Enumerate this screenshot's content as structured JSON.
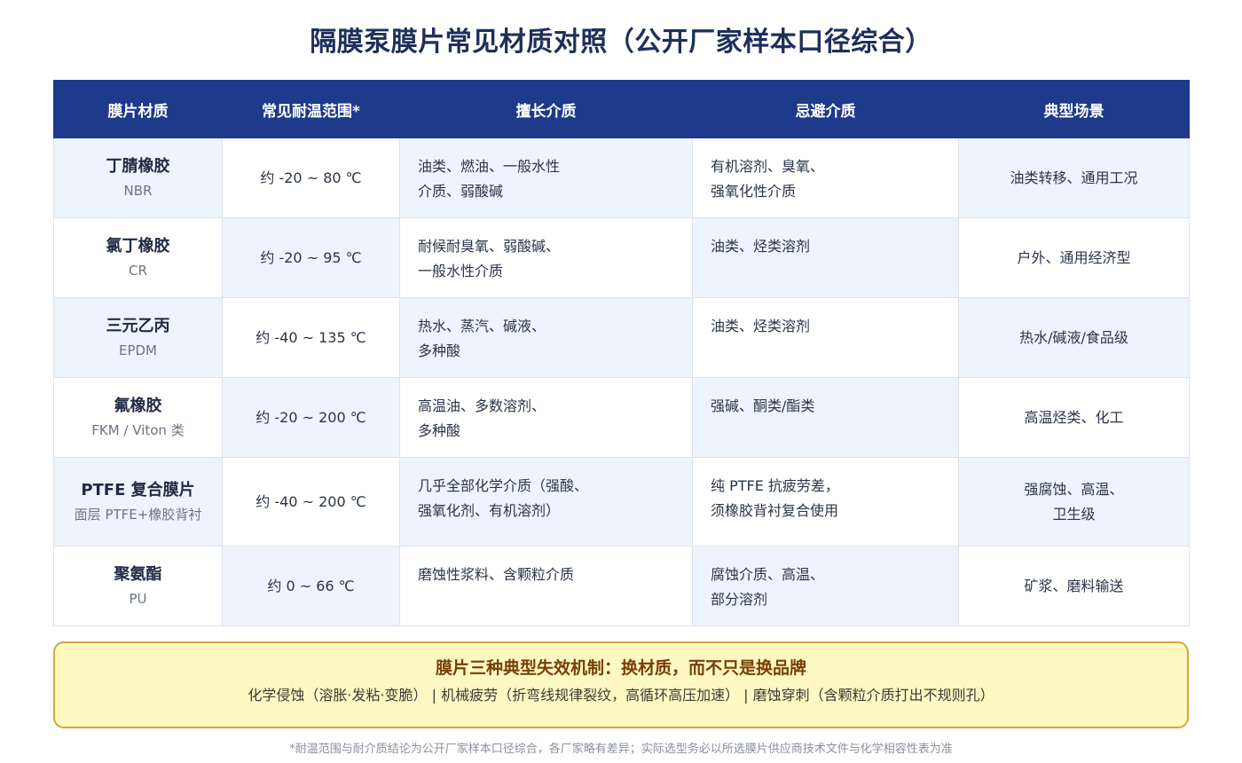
{
  "title": "隔膜泵膜片常见材质对照（公开厂家样本口径综合）",
  "headers": [
    "膜片材质",
    "常见耐温范围*",
    "擅长介质",
    "忌避介质",
    "典型场景"
  ],
  "rows": [
    {
      "name": "丁腈橡胶",
      "sub": "NBR",
      "temp": "约 -20 ~ 80 ℃",
      "good": [
        "油类、燃油、一般水性",
        "介质、弱酸碱"
      ],
      "avoid": [
        "有机溶剂、臭氧、",
        "强氧化性介质"
      ],
      "scene": [
        "油类转移、通用工况"
      ]
    },
    {
      "name": "氯丁橡胶",
      "sub": "CR",
      "temp": "约 -20 ~ 95 ℃",
      "good": [
        "耐候耐臭氧、弱酸碱、",
        "一般水性介质"
      ],
      "avoid": [
        "油类、烃类溶剂"
      ],
      "scene": [
        "户外、通用经济型"
      ]
    },
    {
      "name": "三元乙丙",
      "sub": "EPDM",
      "temp": "约 -40 ~ 135 ℃",
      "good": [
        "热水、蒸汽、碱液、",
        "多种酸"
      ],
      "avoid": [
        "油类、烃类溶剂"
      ],
      "scene": [
        "热水/碱液/食品级"
      ]
    },
    {
      "name": "氟橡胶",
      "sub": "FKM / Viton 类",
      "temp": "约 -20 ~ 200 ℃",
      "good": [
        "高温油、多数溶剂、",
        "多种酸"
      ],
      "avoid": [
        "强碱、酮类/酯类"
      ],
      "scene": [
        "高温烃类、化工"
      ]
    },
    {
      "name": "PTFE 复合膜片",
      "sub": "面层 PTFE+橡胶背衬",
      "temp": "约 -40 ~ 200 ℃",
      "good": [
        "几乎全部化学介质（强酸、",
        "强氧化剂、有机溶剂）"
      ],
      "avoid": [
        "纯 PTFE 抗疲劳差，",
        "须橡胶背衬复合使用"
      ],
      "scene": [
        "强腐蚀、高温、",
        "卫生级"
      ]
    },
    {
      "name": "聚氨酯",
      "sub": "PU",
      "temp": "约 0 ~ 66 ℃",
      "good": [
        "磨蚀性浆料、含颗粒介质"
      ],
      "avoid": [
        "腐蚀介质、高温、",
        "部分溶剂"
      ],
      "scene": [
        "矿浆、磨料输送"
      ]
    }
  ],
  "callout": {
    "title": "膜片三种典型失效机制：换材质，而不只是换品牌",
    "text": "化学侵蚀（溶胀·发粘·变脆） | 机械疲劳（折弯线规律裂纹，高循环高压加速） | 磨蚀穿刺（含颗粒介质打出不规则孔）"
  },
  "footnote": "*耐温范围与耐介质结论为公开厂家样本口径综合，各厂家略有差异；实际选型务必以所选膜片供应商技术文件与化学相容性表为准"
}
